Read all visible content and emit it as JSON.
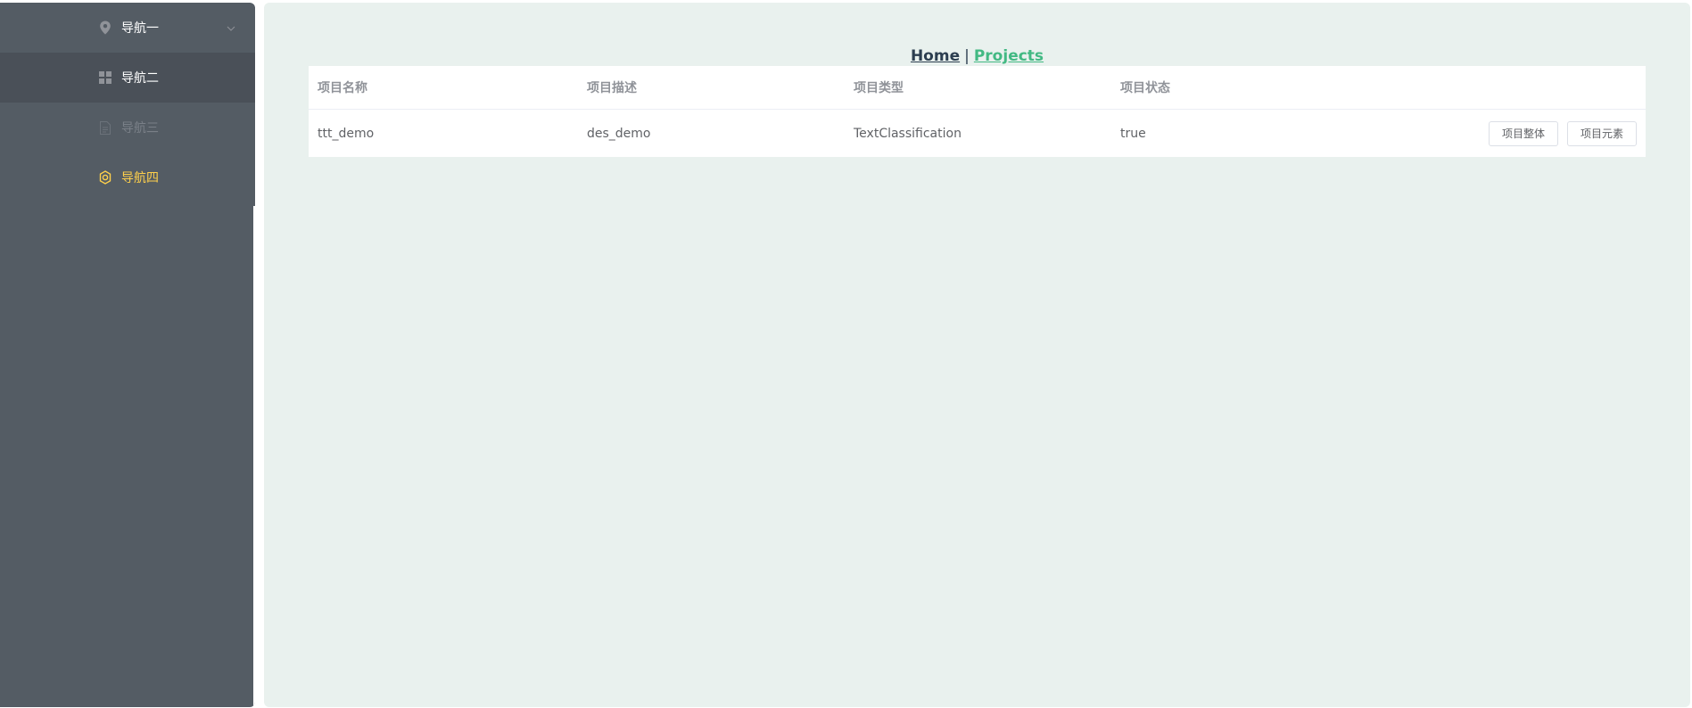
{
  "sidebar": {
    "items": [
      {
        "label": "导航一",
        "icon": "location-icon"
      },
      {
        "label": "导航二",
        "icon": "menu-grid-icon"
      },
      {
        "label": "导航三",
        "icon": "document-icon"
      },
      {
        "label": "导航四",
        "icon": "setting-icon"
      }
    ],
    "colors": {
      "background": "#545c64",
      "active_text": "#ffd04b",
      "disabled_text": "#7a8088"
    }
  },
  "nav": {
    "home": "Home",
    "separator": "|",
    "projects": "Projects"
  },
  "table": {
    "columns": [
      "项目名称",
      "项目描述",
      "项目类型",
      "项目状态"
    ],
    "rows": [
      {
        "name": "ttt_demo",
        "description": "des_demo",
        "type": "TextClassification",
        "status": "true",
        "actions": [
          "项目整体",
          "项目元素"
        ]
      }
    ]
  }
}
